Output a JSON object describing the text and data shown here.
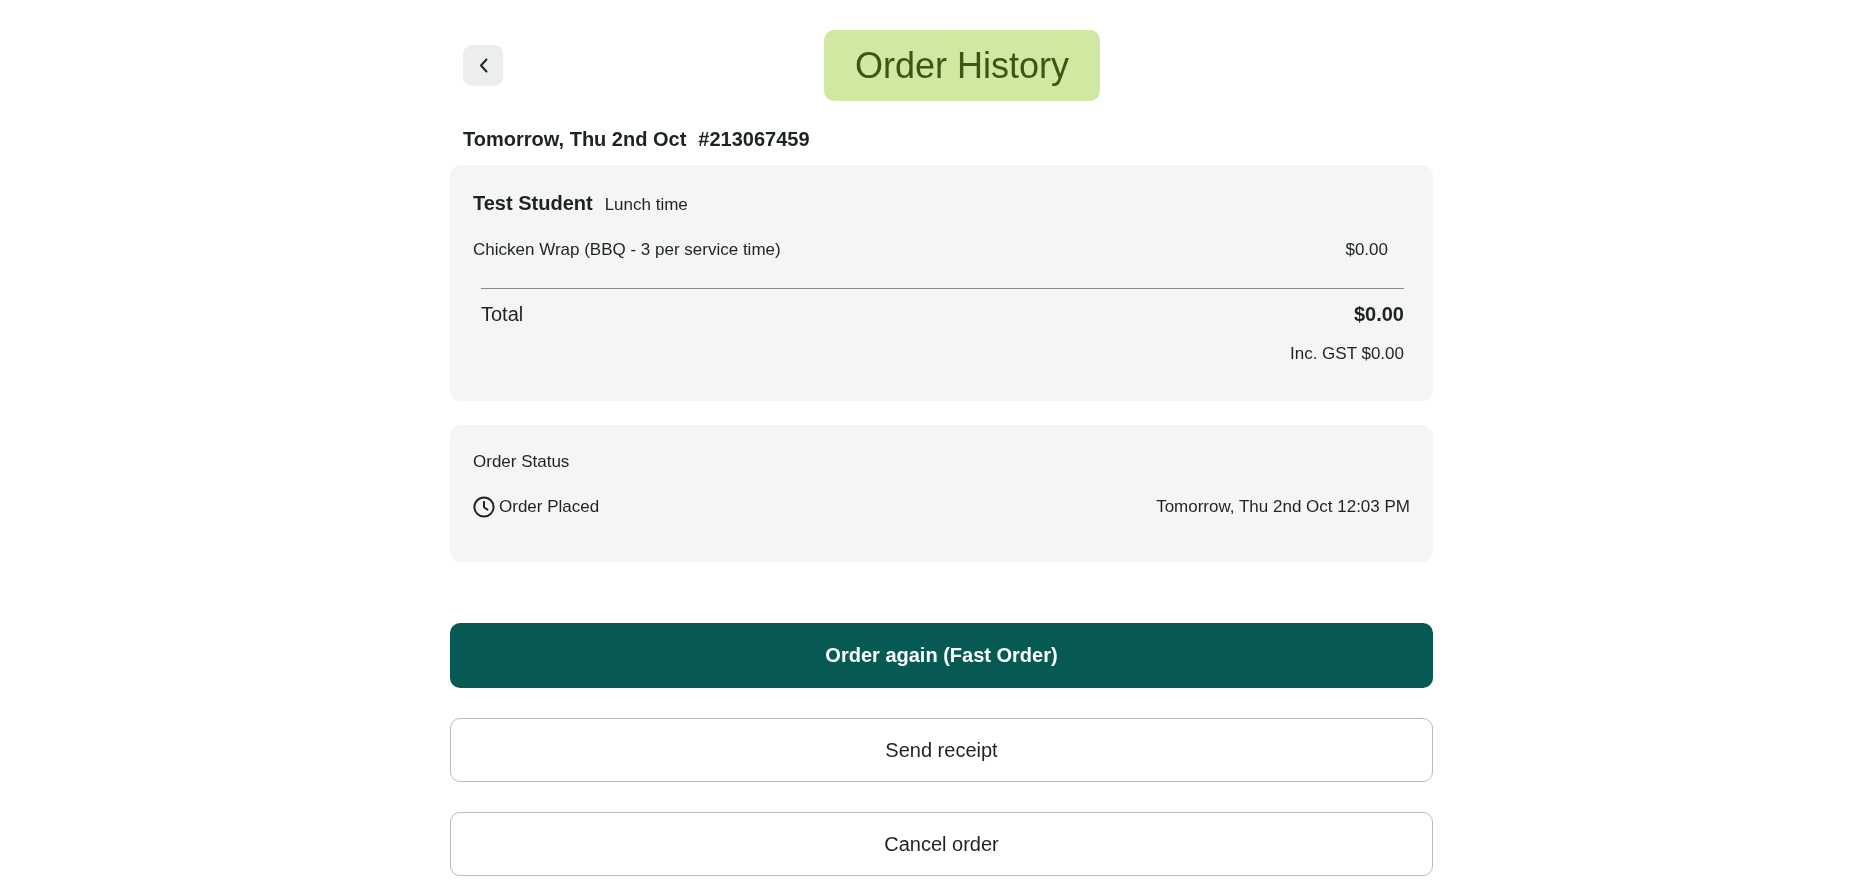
{
  "header": {
    "title": "Order History"
  },
  "order": {
    "date": "Tomorrow, Thu 2nd Oct",
    "number": "#213067459"
  },
  "summary": {
    "student": "Test Student",
    "service_time": "Lunch time",
    "items": [
      {
        "name": "Chicken Wrap (BBQ - 3 per service time)",
        "price": "$0.00"
      }
    ],
    "total_label": "Total",
    "total": "$0.00",
    "gst": "Inc. GST $0.00"
  },
  "status": {
    "heading": "Order Status",
    "events": [
      {
        "label": "Order Placed",
        "time": "Tomorrow, Thu 2nd Oct 12:03 PM"
      }
    ]
  },
  "actions": [
    {
      "label": "Order again (Fast Order)",
      "kind": "primary"
    },
    {
      "label": "Send receipt",
      "kind": "outline"
    },
    {
      "label": "Cancel order",
      "kind": "outline"
    }
  ]
}
